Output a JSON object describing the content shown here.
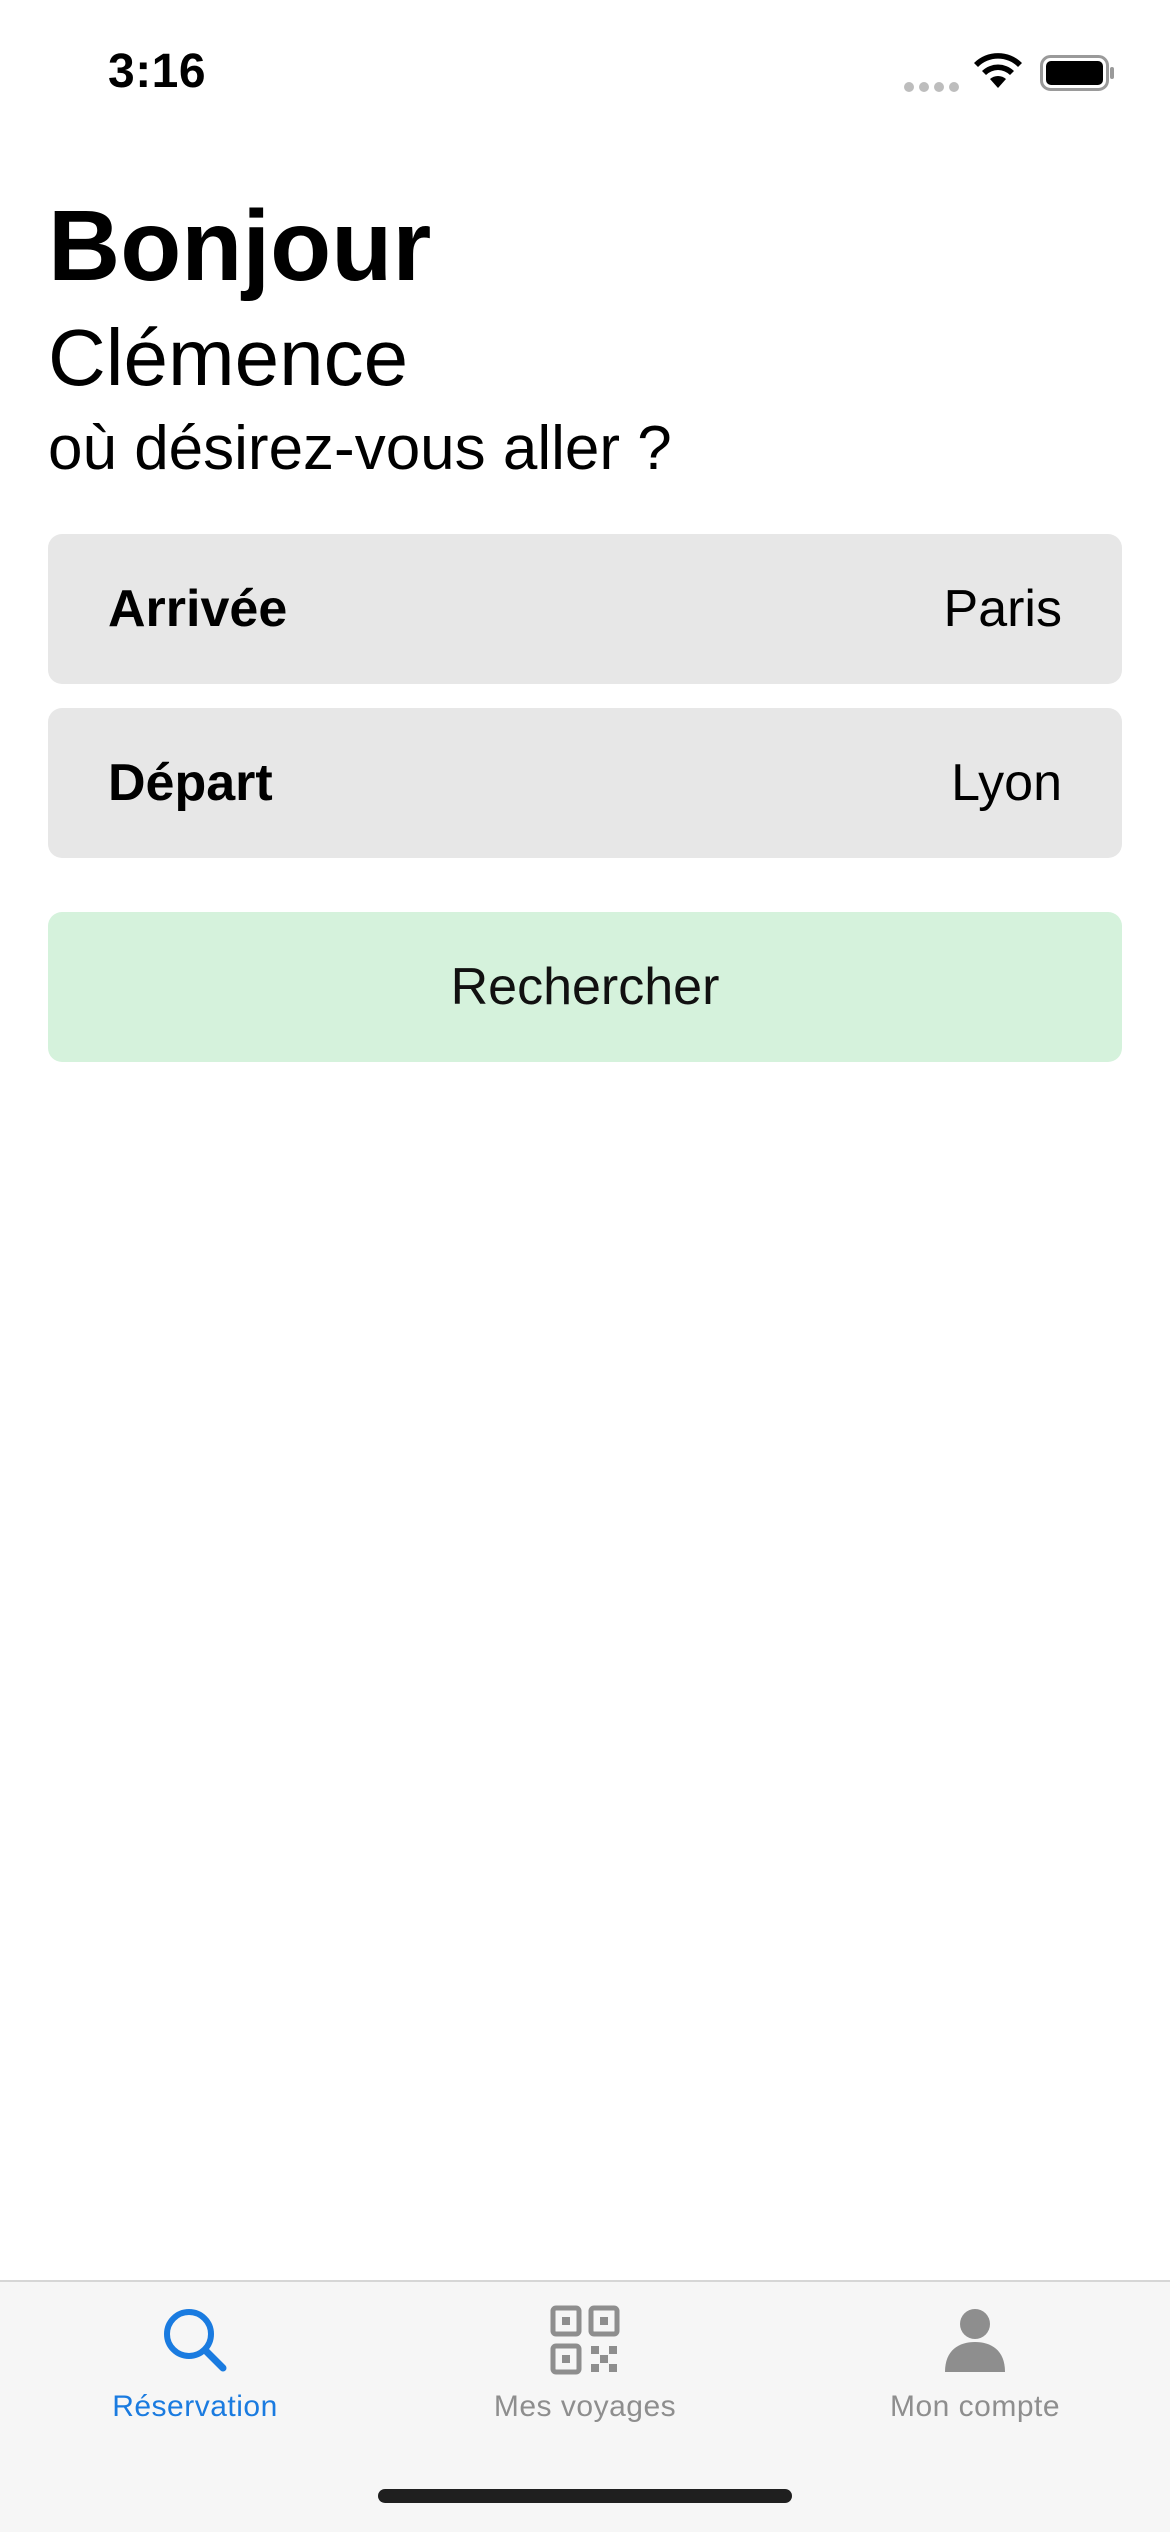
{
  "status_bar": {
    "time": "3:16"
  },
  "header": {
    "greeting": "Bonjour",
    "name": "Clémence",
    "question": "où désirez-vous aller ?"
  },
  "form": {
    "arrival": {
      "label": "Arrivée",
      "value": "Paris"
    },
    "departure": {
      "label": "Départ",
      "value": "Lyon"
    },
    "search_label": "Rechercher"
  },
  "tab_bar": {
    "tabs": [
      {
        "label": "Réservation",
        "icon": "search-icon",
        "active": true
      },
      {
        "label": "Mes voyages",
        "icon": "qr-code-icon",
        "active": false
      },
      {
        "label": "Mon compte",
        "icon": "person-icon",
        "active": false
      }
    ]
  },
  "colors": {
    "accent": "#1a7be0",
    "field_background": "#e7e7e7",
    "search_button_background": "#d5f2dc",
    "inactive_tab": "#8e8e8e"
  }
}
